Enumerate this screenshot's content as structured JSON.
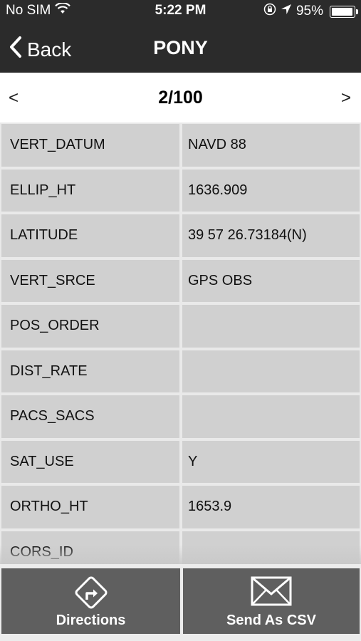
{
  "status": {
    "carrier": "No SIM",
    "time": "5:22 PM",
    "battery_percent_label": "95%",
    "battery_level": 0.95,
    "icons": [
      "wifi-icon",
      "orientation-lock-icon",
      "location-arrow-icon",
      "battery-icon"
    ]
  },
  "nav": {
    "back_label": "Back",
    "title": "PONY"
  },
  "pager": {
    "prev": "<",
    "page": "2/100",
    "next": ">"
  },
  "rows": [
    {
      "key": "VERT_DATUM",
      "value": "NAVD 88"
    },
    {
      "key": "ELLIP_HT",
      "value": "1636.909"
    },
    {
      "key": "LATITUDE",
      "value": "39 57 26.73184(N)"
    },
    {
      "key": "VERT_SRCE",
      "value": "GPS OBS"
    },
    {
      "key": "POS_ORDER",
      "value": ""
    },
    {
      "key": "DIST_RATE",
      "value": ""
    },
    {
      "key": "PACS_SACS",
      "value": ""
    },
    {
      "key": "SAT_USE",
      "value": "Y"
    },
    {
      "key": "ORTHO_HT",
      "value": "1653.9"
    },
    {
      "key": "CORS_ID",
      "value": ""
    }
  ],
  "bottom": {
    "directions_label": "Directions",
    "directions_icon": "directions-icon",
    "csv_label": "Send As CSV",
    "csv_icon": "envelope-icon"
  }
}
